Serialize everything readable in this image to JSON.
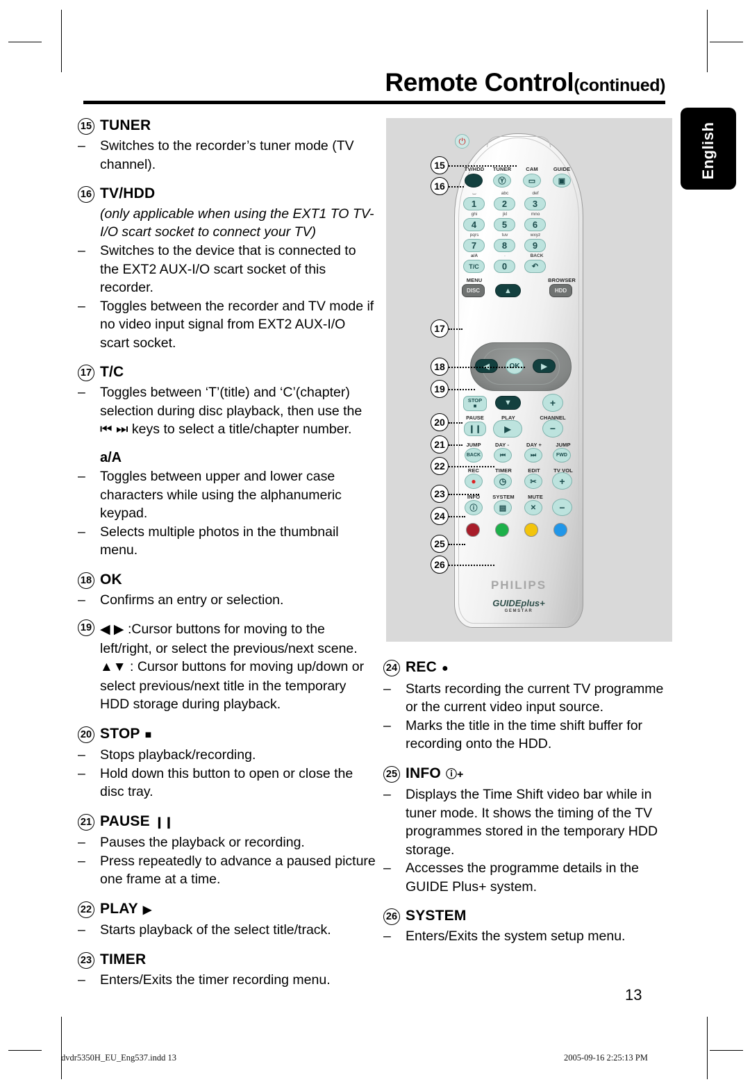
{
  "header": {
    "title": "Remote Control",
    "continued": "(continued)",
    "side_tab": "English"
  },
  "page": {
    "number": "13"
  },
  "footer": {
    "file": "dvdr5350H_EU_Eng537.indd  13",
    "timestamp": "2005-09-16  2:25:13 PM"
  },
  "left_column": {
    "entries": [
      {
        "num": "15",
        "label": "TUNER",
        "bullets": [
          "Switches to the recorder’s tuner mode (TV channel)."
        ]
      },
      {
        "num": "16",
        "label": "TV/HDD",
        "note": "(only applicable when using the EXT1 TO TV-I/O scart socket to connect your TV)",
        "bullets": [
          "Switches to the device that is connected to the EXT2 AUX-I/O scart socket of this recorder.",
          "Toggles between the recorder and TV mode if no video input signal from EXT2 AUX-I/O scart socket."
        ]
      },
      {
        "num": "17",
        "label": "T/C",
        "bullets": [
          "Toggles between ‘T’(title) and ‘C’(chapter) selection during disc playback, then use the ⏮ ⏭ keys to select a title/chapter number."
        ],
        "sub_label": "a/A",
        "sub_bullets": [
          "Toggles between upper and lower case characters while using the alphanumeric keypad.",
          "Selects multiple photos in the thumbnail menu."
        ]
      },
      {
        "num": "18",
        "label": "OK",
        "bullets": [
          "Confirms an entry or selection."
        ]
      },
      {
        "num": "19",
        "label": "",
        "inline_glyph": "◀ ▶",
        "inline_text": ":Cursor buttons for moving to the left/right, or select the previous/next scene.",
        "para_glyph": "▲▼",
        "para_text": " : Cursor buttons for moving up/down or select previous/next title in the temporary HDD storage during playback."
      },
      {
        "num": "20",
        "label": "STOP",
        "glyph": "■",
        "bullets": [
          "Stops playback/recording.",
          "Hold down this button to open or close the disc tray."
        ]
      },
      {
        "num": "21",
        "label": "PAUSE",
        "glyph": "❙❙",
        "bullets": [
          "Pauses the playback or recording.",
          "Press repeatedly to advance a paused picture one frame at a time."
        ]
      },
      {
        "num": "22",
        "label": "PLAY",
        "glyph": "▶",
        "bullets": [
          "Starts playback of the select title/track."
        ]
      },
      {
        "num": "23",
        "label": "TIMER",
        "bullets": [
          "Enters/Exits the timer recording menu."
        ]
      }
    ]
  },
  "right_column": {
    "entries": [
      {
        "num": "24",
        "label": "REC",
        "glyph": "●",
        "bullets": [
          "Starts recording the current TV programme or the current video input source.",
          "Marks the title in the time shift buffer for recording onto the HDD."
        ]
      },
      {
        "num": "25",
        "label": "INFO",
        "glyph": "ⓘ+",
        "bullets": [
          "Displays the Time Shift video bar while in tuner mode. It shows the timing of the TV programmes stored in the temporary HDD storage.",
          "Accesses the programme details in the GUIDE Plus+ system."
        ]
      },
      {
        "num": "26",
        "label": "SYSTEM",
        "bullets": [
          "Enters/Exits the system setup menu."
        ]
      }
    ]
  },
  "remote": {
    "brand": "PHILIPS",
    "guide_logo": "GUIDEplus+",
    "gemstar": "GEMSTAR",
    "row_source": [
      {
        "label": "TV/HDD",
        "key": ""
      },
      {
        "label": "TUNER",
        "key": "Ⓨ"
      },
      {
        "label": "CAM",
        "key": "▭"
      },
      {
        "label": "GUIDE",
        "key": "▣"
      }
    ],
    "keypad": [
      {
        "hint": "⌴",
        "digit": "1"
      },
      {
        "hint": "abc",
        "digit": "2"
      },
      {
        "hint": "def",
        "digit": "3"
      },
      {
        "hint": "ghi",
        "digit": "4"
      },
      {
        "hint": "jkl",
        "digit": "5"
      },
      {
        "hint": "mno",
        "digit": "6"
      },
      {
        "hint": "pqrs",
        "digit": "7"
      },
      {
        "hint": "tuv",
        "digit": "8"
      },
      {
        "hint": "wxyz",
        "digit": "9"
      },
      {
        "hint": "a/A",
        "digit": "T/C"
      },
      {
        "hint": "·",
        "digit": "0"
      },
      {
        "hint": "BACK",
        "digit": "↶"
      }
    ],
    "menu_row": [
      {
        "label": "MENU",
        "key": "DISC"
      },
      {
        "label": "",
        "key": "▲"
      },
      {
        "label": "BROWSER",
        "key": "HDD"
      }
    ],
    "nav": {
      "left": "◀",
      "ok": "OK",
      "right": "▶",
      "down": "▼"
    },
    "transport": [
      {
        "label": "STOP",
        "key": "■"
      },
      {
        "label": "PAUSE",
        "key": "❙❙"
      },
      {
        "label": "PLAY",
        "key": "▶"
      },
      {
        "label": "CHANNEL",
        "key_plus": "+",
        "key_minus": "−"
      }
    ],
    "jump_row": [
      {
        "label": "JUMP",
        "key": "BACK"
      },
      {
        "label": "DAY -",
        "key": "⏮"
      },
      {
        "label": "DAY +",
        "key": "⏭"
      },
      {
        "label": "JUMP",
        "key": "FWD"
      }
    ],
    "rec_row": [
      {
        "label": "REC",
        "key": "●"
      },
      {
        "label": "TIMER",
        "key": "◷"
      },
      {
        "label": "EDIT",
        "key": "✂"
      },
      {
        "label": "TV VOL",
        "key": "+"
      }
    ],
    "info_row": [
      {
        "label": "INFO",
        "key": "ⓘ"
      },
      {
        "label": "SYSTEM",
        "key": "▤"
      },
      {
        "label": "MUTE",
        "key": "✕"
      },
      {
        "label": "",
        "key": "−"
      }
    ],
    "color_buttons": [
      "#a81d2a",
      "#1db04a",
      "#f2c40c",
      "#2196e8"
    ],
    "callouts": [
      "15",
      "16",
      "17",
      "18",
      "19",
      "20",
      "21",
      "22",
      "23",
      "24",
      "25",
      "26"
    ]
  }
}
